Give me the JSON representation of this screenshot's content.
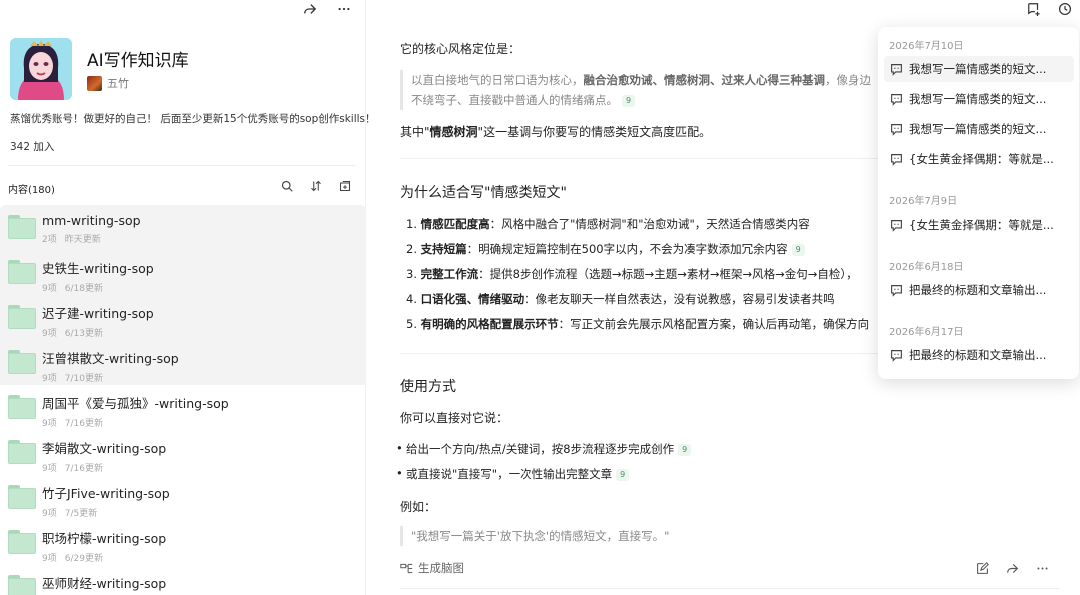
{
  "left": {
    "kb_title": "AI写作知识库",
    "author": "五竹",
    "description": "蒸馏优秀账号！做更好的自己！ 后面至少更新15个优秀账号的sop创作skills！",
    "joined": "342 加入",
    "content_header": "内容(180)",
    "items": [
      {
        "name": "mm-writing-sop",
        "count": "2项",
        "updated": "昨天更新"
      },
      {
        "name": "史铁生-writing-sop",
        "count": "9项",
        "updated": "6/18更新"
      },
      {
        "name": "迟子建-writing-sop",
        "count": "9项",
        "updated": "6/13更新"
      },
      {
        "name": "汪曾祺散文-writing-sop",
        "count": "9项",
        "updated": "7/10更新"
      },
      {
        "name": "周国平《爱与孤独》-writing-sop",
        "count": "9项",
        "updated": "7/16更新"
      },
      {
        "name": "李娟散文-writing-sop",
        "count": "9项",
        "updated": "7/16更新"
      },
      {
        "name": "竹子JFive-writing-sop",
        "count": "9项",
        "updated": "7/5更新"
      },
      {
        "name": "职场柠檬-writing-sop",
        "count": "9项",
        "updated": "6/29更新"
      },
      {
        "name": "巫师财经-writing-sop",
        "count": "",
        "updated": ""
      }
    ]
  },
  "doc": {
    "intro": "它的核心风格定位是：",
    "quote_line1_pre": "以直白接地气的日常口语为核心，",
    "quote_line1_bold": "融合治愈劝诫、情感树洞、过来人心得三种基调",
    "quote_line1_post": "，像身边",
    "quote_line2": "不绕弯子、直接戳中普通人的情绪痛点。",
    "badge": "9",
    "match_pre": "其中\"",
    "match_bold": "情感树洞",
    "match_post": "\"这一基调与你要写的情感类短文高度匹配。",
    "why_title": "为什么适合写\"情感类短文\"",
    "reasons": [
      {
        "num": "1.",
        "bold": "情感匹配度高",
        "text": "：风格中融合了\"情感树洞\"和\"治愈劝诫\"，天然适合情感类内容",
        "badge": ""
      },
      {
        "num": "2.",
        "bold": "支持短篇",
        "text": "：明确规定短篇控制在500字以内，不会为凑字数添加冗余内容",
        "badge": "9"
      },
      {
        "num": "3.",
        "bold": "完整工作流",
        "text": "：提供8步创作流程（选题→标题→主题→素材→框架→风格→金句→自检），",
        "badge": ""
      },
      {
        "num": "4.",
        "bold": "口语化强、情绪驱动",
        "text": "：像老友聊天一样自然表达，没有说教感，容易引发读者共鸣",
        "badge": ""
      },
      {
        "num": "5.",
        "bold": "有明确的风格配置展示环节",
        "text": "：写正文前会先展示风格配置方案，确认后再动笔，确保方向",
        "badge": ""
      }
    ],
    "usage_title": "使用方式",
    "usage_intro": "你可以直接对它说：",
    "usage_items": [
      {
        "text": "给出一个方向/热点/关键词，按8步流程逐步完成创作",
        "badge": "9"
      },
      {
        "text": "或直接说\"直接写\"，一次性输出完整文章",
        "badge": "9"
      }
    ],
    "example_label": "例如：",
    "example_quote": "\"我想写一篇关于'放下执念'的情感短文，直接写。\"",
    "mindmap_label": "生成脑图"
  },
  "history": {
    "groups": [
      {
        "date": "2026年7月10日",
        "items": [
          "我想写一篇情感类的短文...",
          "我想写一篇情感类的短文...",
          "我想写一篇情感类的短文...",
          "{女生黄金择偶期：等就是..."
        ]
      },
      {
        "date": "2026年7月9日",
        "items": [
          "{女生黄金择偶期：等就是..."
        ]
      },
      {
        "date": "2026年6月18日",
        "items": [
          "把最终的标题和文章输出..."
        ]
      },
      {
        "date": "2026年6月17日",
        "items": [
          "把最终的标题和文章输出..."
        ]
      }
    ]
  },
  "colors": {
    "accent_green": "#4a8f67",
    "folder": "#c4e7cf",
    "highlight": "#f3f3f3"
  }
}
